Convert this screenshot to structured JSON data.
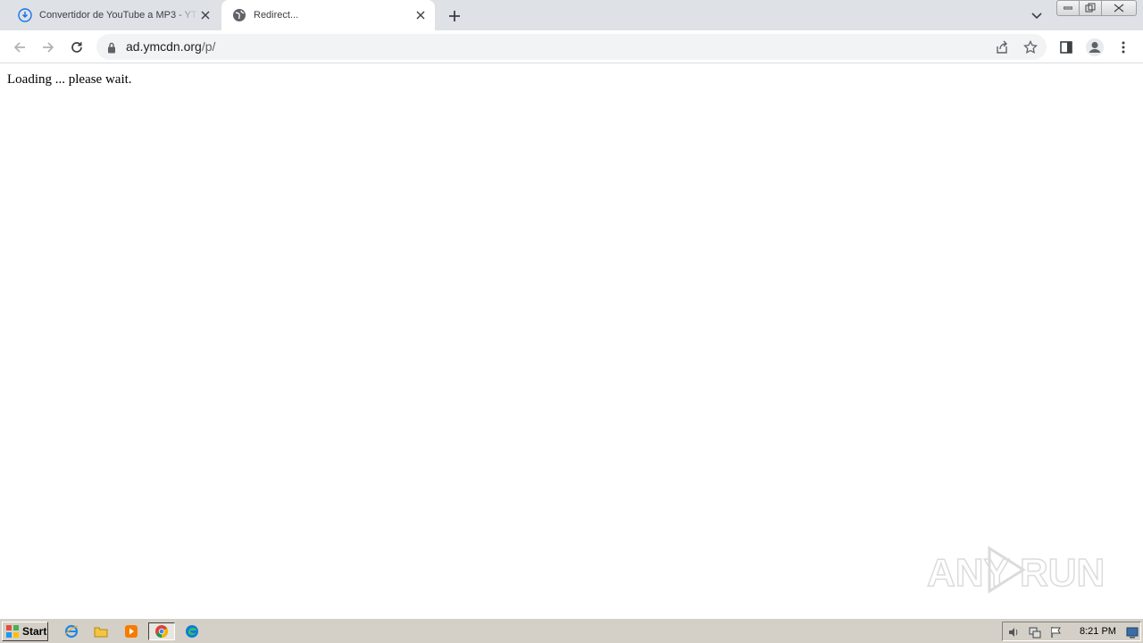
{
  "tabs": [
    {
      "title": "Convertidor de YouTube a MP3 - YTMP3",
      "icon": "download-cloud-icon",
      "active": false
    },
    {
      "title": "Redirect...",
      "icon": "globe-icon",
      "active": true
    }
  ],
  "address_bar": {
    "host": "ad.ymcdn.org",
    "path": "/p/"
  },
  "page": {
    "loading_text": "Loading ... please wait."
  },
  "watermark": {
    "text_left": "ANY",
    "text_right": "RUN"
  },
  "taskbar": {
    "start_label": "Start",
    "clock": "8:21 PM"
  }
}
